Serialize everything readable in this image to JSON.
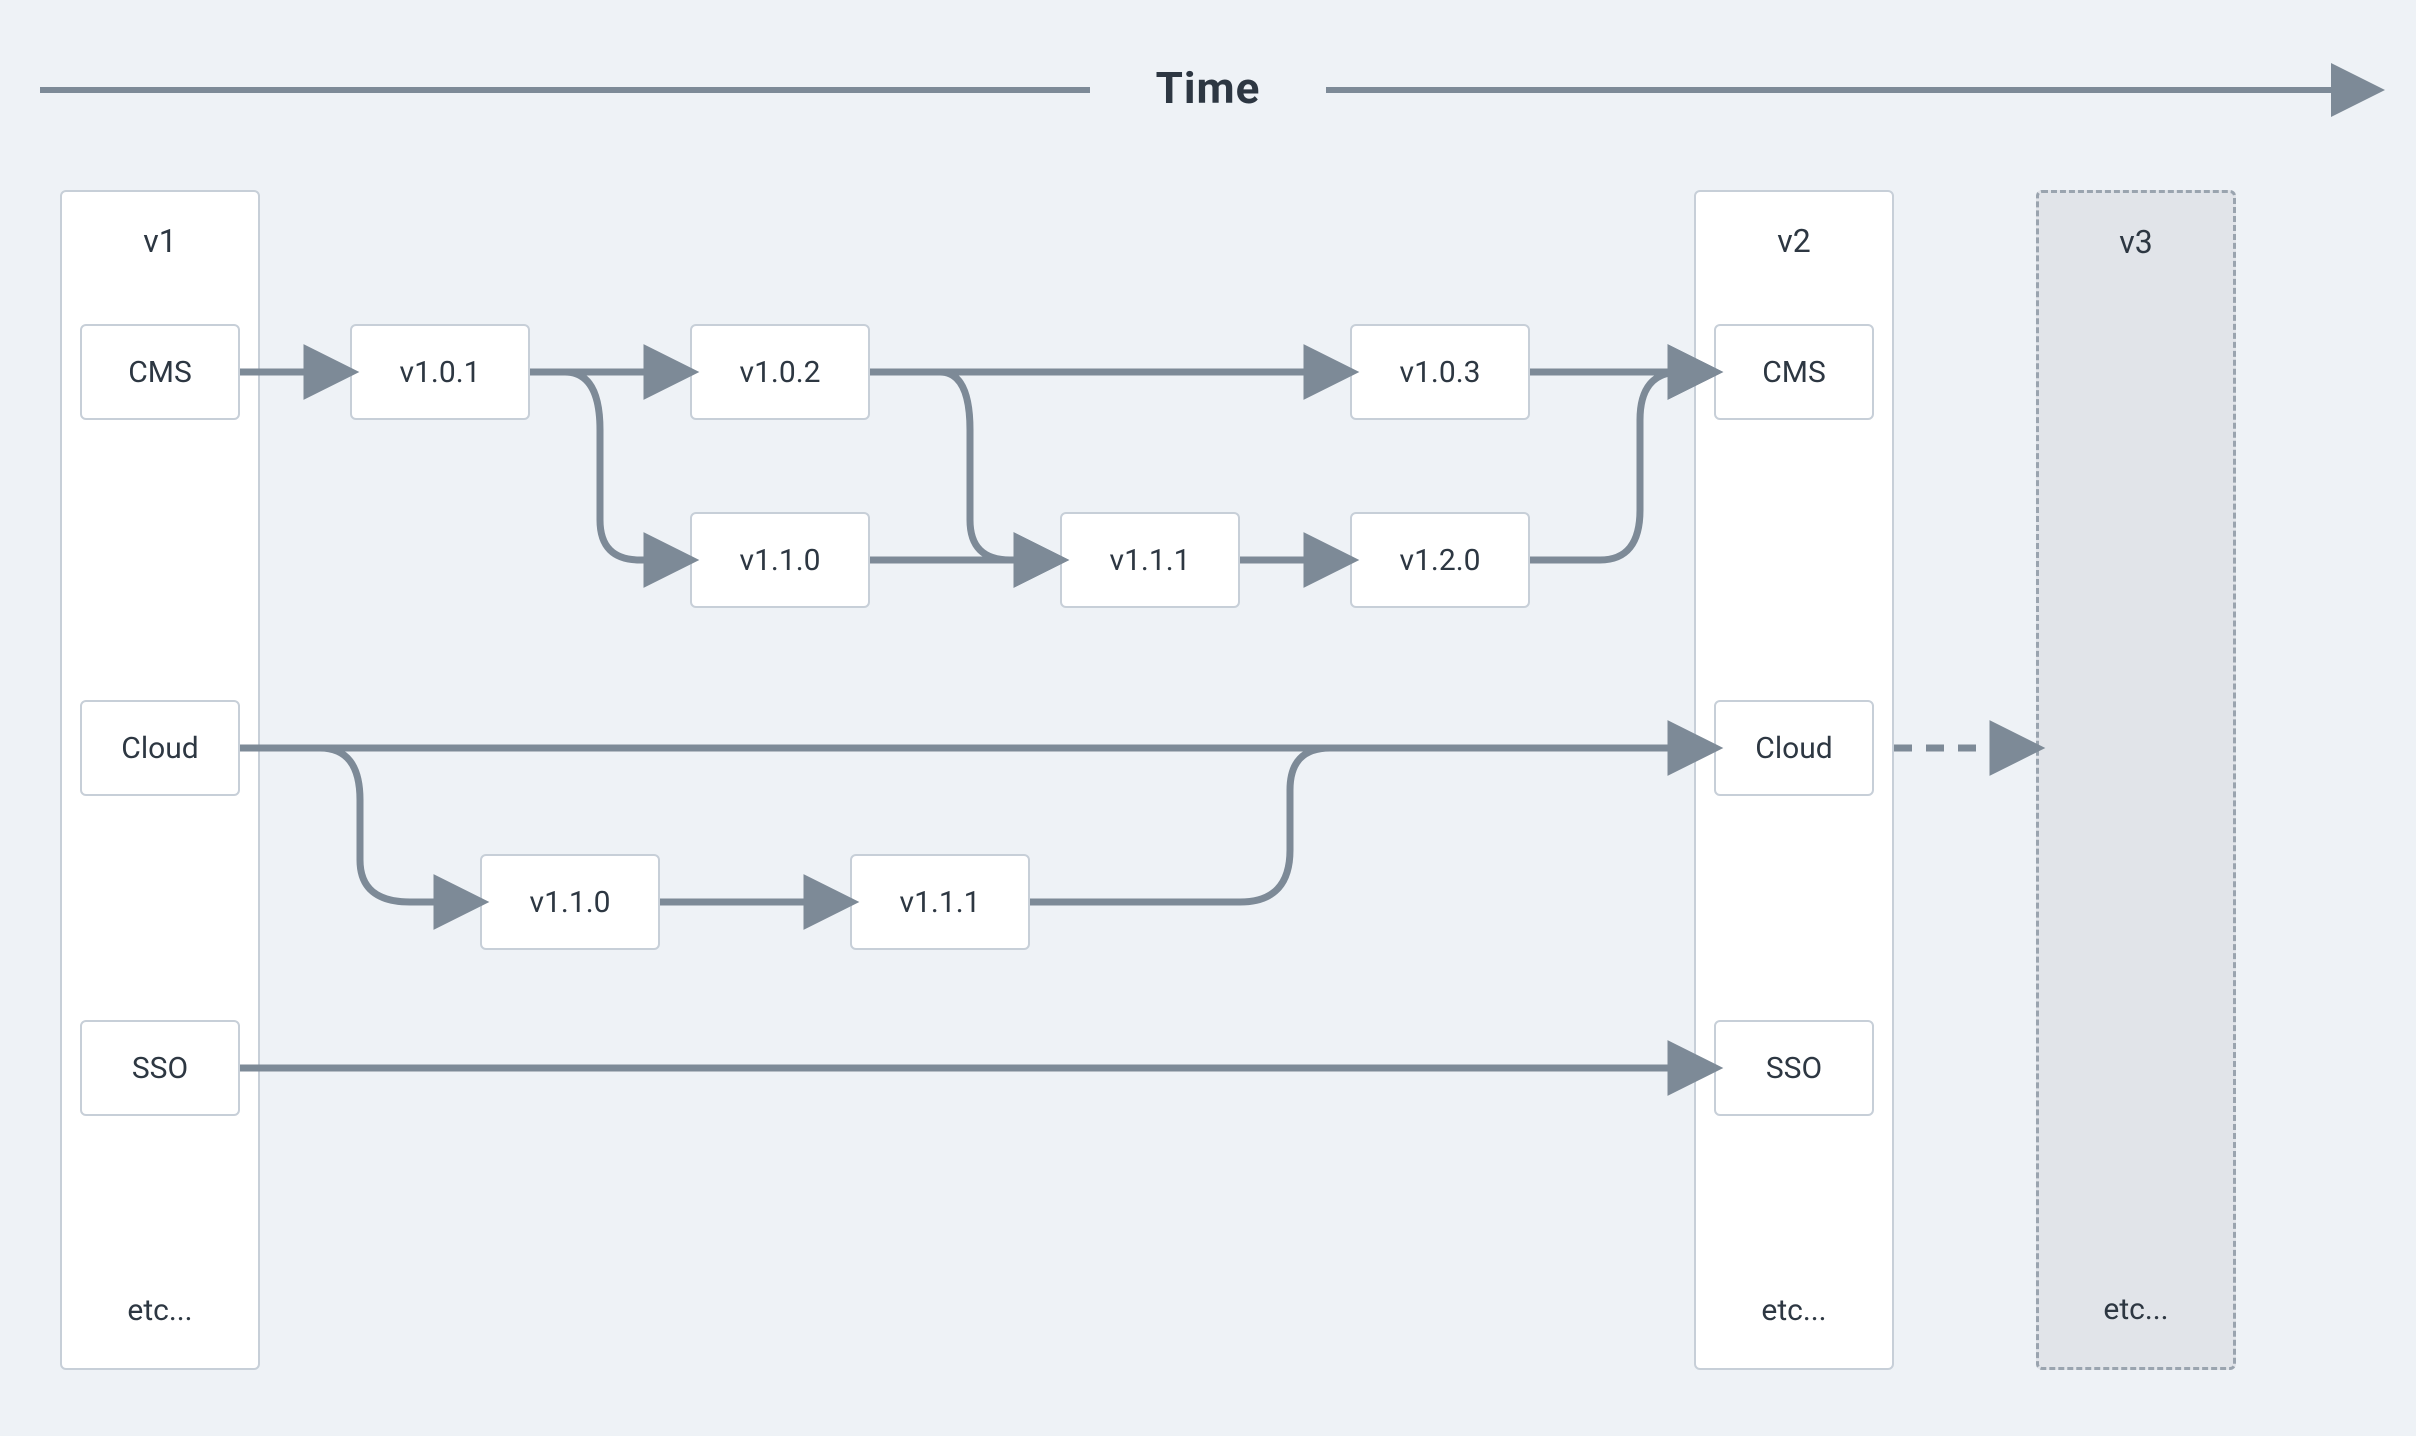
{
  "axis": {
    "label": "Time"
  },
  "columns": {
    "v1": {
      "title": "v1",
      "items": {
        "cms": "CMS",
        "cloud": "Cloud",
        "sso": "SSO"
      },
      "etc": "etc..."
    },
    "v2": {
      "title": "v2",
      "items": {
        "cms": "CMS",
        "cloud": "Cloud",
        "sso": "SSO"
      },
      "etc": "etc..."
    },
    "v3": {
      "title": "v3",
      "etc": "etc..."
    }
  },
  "versions": {
    "cms": {
      "r1": {
        "a": "v1.0.1",
        "b": "v1.0.2",
        "c": "v1.0.3"
      },
      "r2": {
        "a": "v1.1.0",
        "b": "v1.1.1",
        "c": "v1.2.0"
      }
    },
    "cloud": {
      "r1": {
        "a": "v1.1.0",
        "b": "v1.1.1"
      }
    }
  },
  "colors": {
    "bg": "#eef2f6",
    "box_bg": "#ffffff",
    "border": "#c7cfd8",
    "arrow": "#7d8a97",
    "text": "#2d3742",
    "future_bg": "#e1e4e9",
    "future_border": "#9aa4af"
  }
}
